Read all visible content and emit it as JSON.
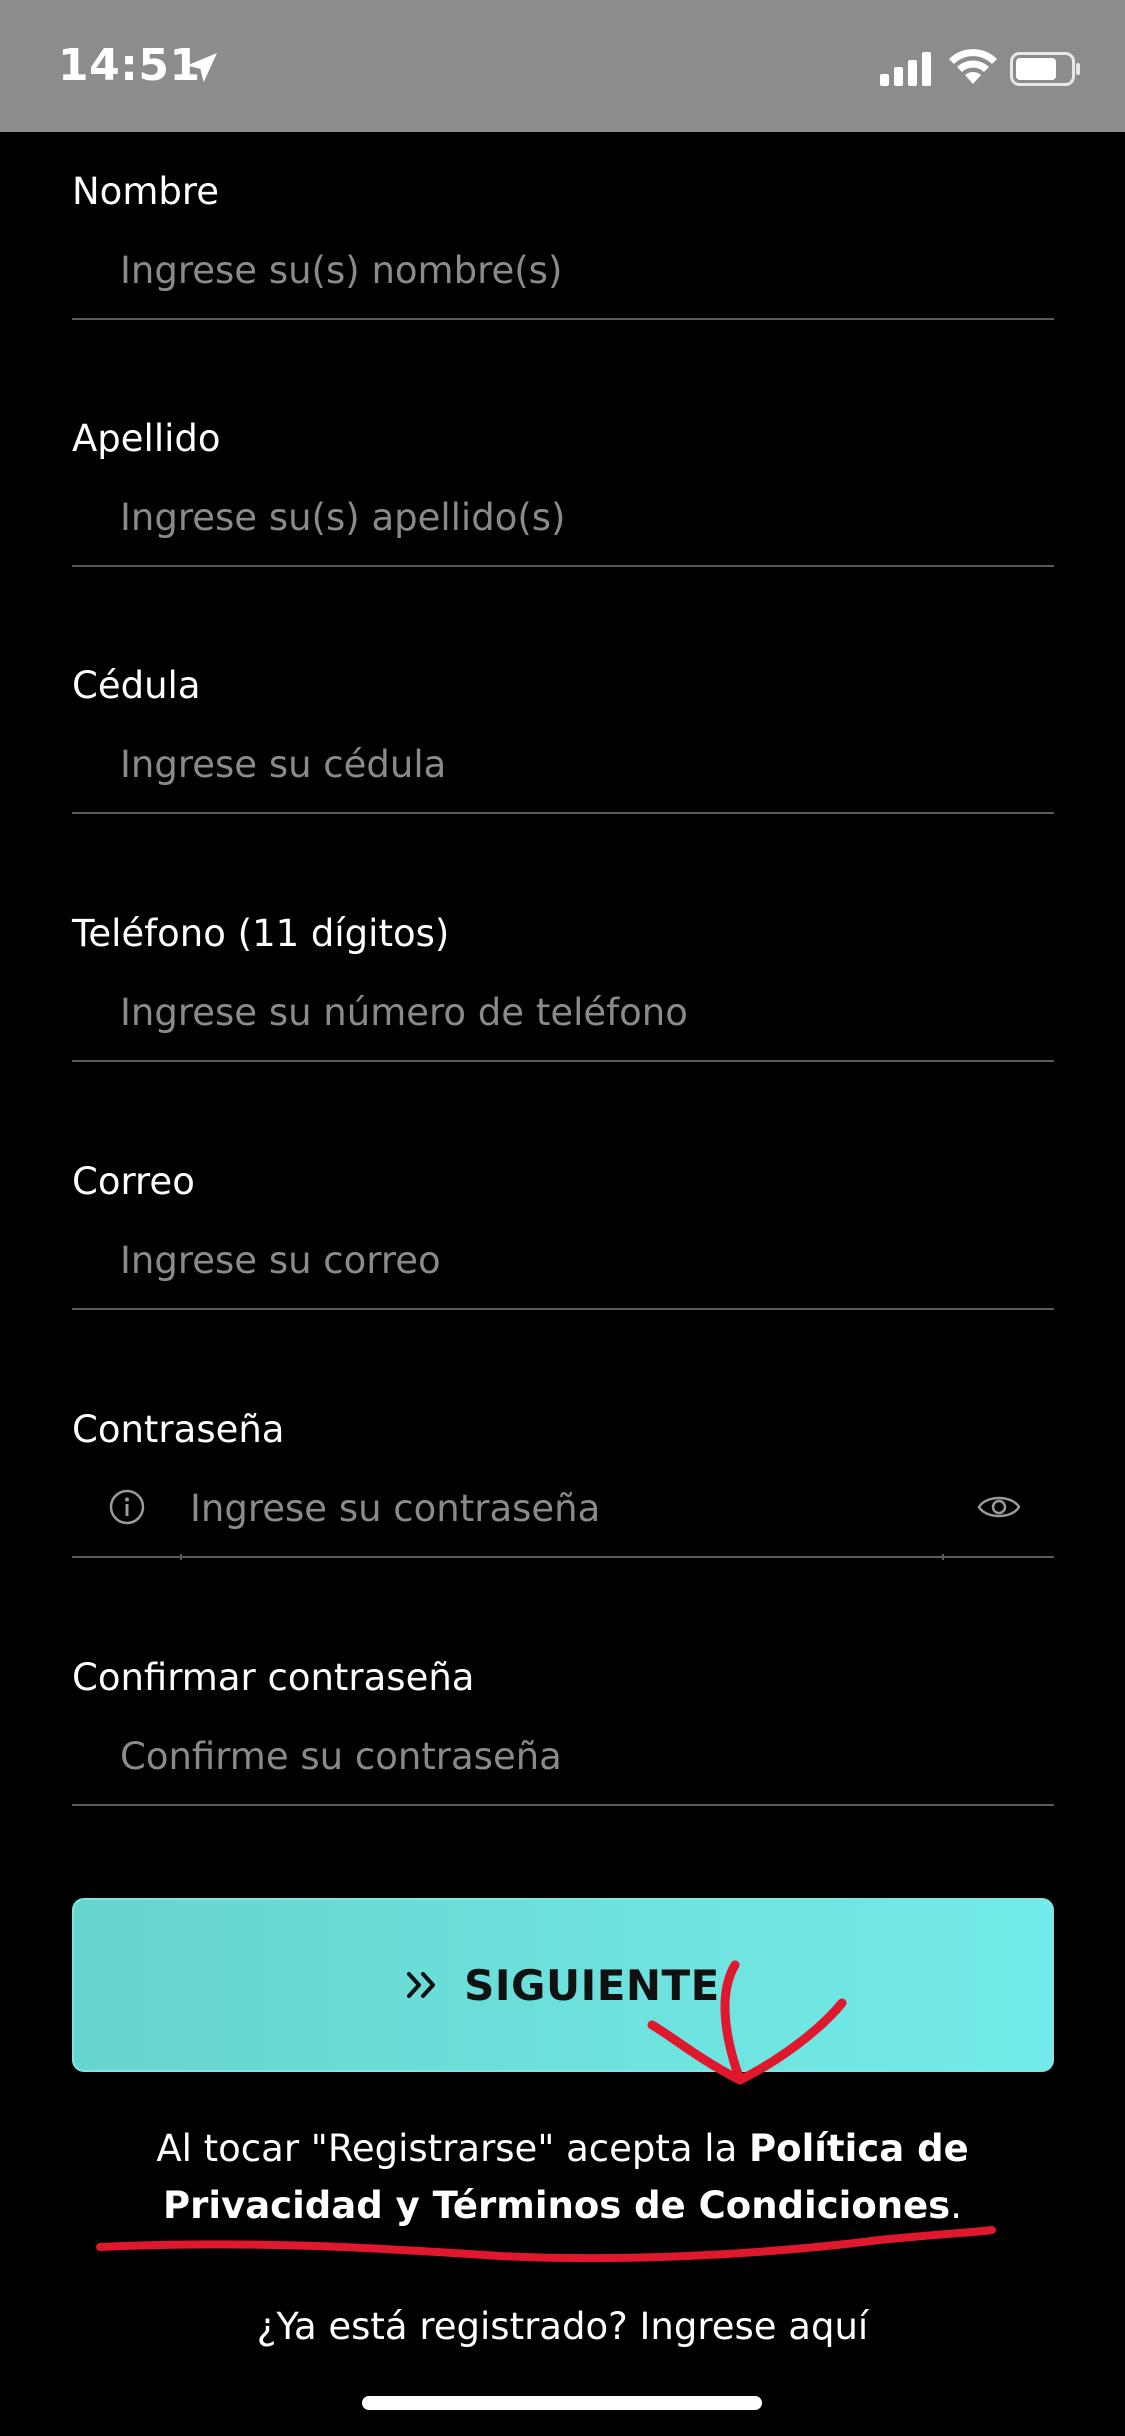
{
  "status_bar": {
    "time": "14:51",
    "icons": [
      "location-arrow-icon",
      "cellular-signal-icon",
      "wifi-icon",
      "battery-icon"
    ]
  },
  "form": {
    "fields": [
      {
        "label": "Nombre",
        "placeholder": "Ingrese su(s) nombre(s)",
        "value": ""
      },
      {
        "label": "Apellido",
        "placeholder": "Ingrese su(s) apellido(s)",
        "value": ""
      },
      {
        "label": "Cédula",
        "placeholder": "Ingrese su cédula",
        "value": ""
      },
      {
        "label": "Teléfono (11 dígitos)",
        "placeholder": "Ingrese su número de teléfono",
        "value": ""
      },
      {
        "label": "Correo",
        "placeholder": "Ingrese su correo",
        "value": ""
      },
      {
        "label": "Contraseña",
        "placeholder": "Ingrese su contraseña",
        "value": ""
      },
      {
        "label": "Confirmar contraseña",
        "placeholder": "Confirme su contraseña",
        "value": ""
      }
    ]
  },
  "next_button": {
    "label": "SIGUIENTE",
    "icon": "double-chevron-right-icon"
  },
  "terms": {
    "prefix": "Al tocar \"Registrarse\" acepta la ",
    "link": "Política de Privacidad y Términos de Condiciones",
    "suffix": "."
  },
  "login_prompt": "¿Ya está registrado? Ingrese aquí",
  "colors": {
    "background": "#000000",
    "status_bar": "#8c8c8c",
    "button_start": "#66d5cd",
    "button_end": "#73ebea",
    "annotation": "#e0182d",
    "placeholder": "#8a8a8a",
    "underline": "#5a5a5a"
  }
}
